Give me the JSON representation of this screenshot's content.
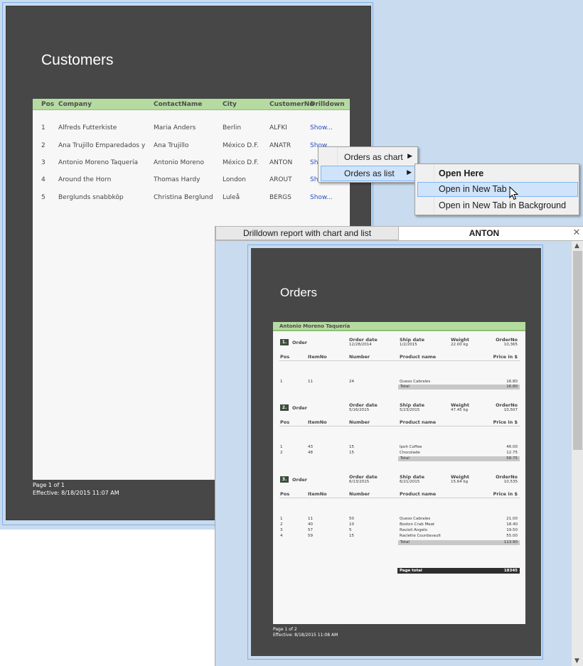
{
  "customers_report": {
    "title": "Customers",
    "columns": [
      "Pos",
      "Company",
      "ContactName",
      "City",
      "CustomerNo",
      "Drilldown"
    ],
    "rows": [
      {
        "pos": "1",
        "company": "Alfreds Futterkiste",
        "contact": "Maria Anders",
        "city": "Berlin",
        "no": "ALFKI",
        "drill": "Show..."
      },
      {
        "pos": "2",
        "company": "Ana Trujillo Emparedados y",
        "contact": "Ana Trujillo",
        "city": "México D.F.",
        "no": "ANATR",
        "drill": "Show..."
      },
      {
        "pos": "3",
        "company": "Antonio Moreno Taquería",
        "contact": "Antonio Moreno",
        "city": "México D.F.",
        "no": "ANTON",
        "drill": "Show..."
      },
      {
        "pos": "4",
        "company": "Around the Horn",
        "contact": "Thomas Hardy",
        "city": "London",
        "no": "AROUT",
        "drill": "Show..."
      },
      {
        "pos": "5",
        "company": "Berglunds snabbköp",
        "contact": "Christina Berglund",
        "city": "Luleå",
        "no": "BERGS",
        "drill": "Show..."
      }
    ],
    "footer_page": "Page 1 of 1",
    "footer_effective": "Effective: 8/18/2015 11:07 AM"
  },
  "context_menu": {
    "items": [
      {
        "label": "Orders as chart",
        "selected": false
      },
      {
        "label": "Orders as list",
        "selected": true
      }
    ],
    "submenu": [
      {
        "label": "Open Here",
        "bold": true,
        "selected": false
      },
      {
        "label": "Open in New Tab",
        "bold": false,
        "selected": true
      },
      {
        "label": "Open in New Tab in Background",
        "bold": false,
        "selected": false
      }
    ]
  },
  "tabs": {
    "tab1": "Drilldown report with chart and list",
    "tab2": "ANTON",
    "close": "✕"
  },
  "orders_report": {
    "title": "Orders",
    "customer": "Antonio Moreno Taquería",
    "group_headers": {
      "order": "Order",
      "order_date": "Order date",
      "ship_date": "Ship date",
      "weight": "Weight",
      "order_no": "OrderNo"
    },
    "item_headers": {
      "pos": "Pos",
      "item_no": "ItemNo",
      "number": "Number",
      "product": "Product name",
      "price": "Price in $"
    },
    "total_label": "Total",
    "page_total_label": "Page total",
    "page_total_value": "18345",
    "orders": [
      {
        "num": "1.",
        "order_date": "12/28/2014",
        "ship_date": "1/2/2015",
        "weight": "22.00 kg",
        "order_no": "10,365",
        "items": [
          {
            "pos": "1",
            "item": "11",
            "number": "24",
            "product": "Queso Cabrales",
            "price": "16.80"
          }
        ],
        "total": "16.80"
      },
      {
        "num": "2.",
        "order_date": "5/16/2015",
        "ship_date": "5/23/2015",
        "weight": "47.45 kg",
        "order_no": "10,507",
        "items": [
          {
            "pos": "1",
            "item": "43",
            "number": "15",
            "product": "Ipoh Coffee",
            "price": "46.00"
          },
          {
            "pos": "2",
            "item": "48",
            "number": "15",
            "product": "Chocolade",
            "price": "12.75"
          }
        ],
        "total": "58.75"
      },
      {
        "num": "3.",
        "order_date": "6/13/2015",
        "ship_date": "6/21/2015",
        "weight": "15.64 kg",
        "order_no": "10,535",
        "items": [
          {
            "pos": "1",
            "item": "11",
            "number": "50",
            "product": "Queso Cabrales",
            "price": "21.00"
          },
          {
            "pos": "2",
            "item": "40",
            "number": "10",
            "product": "Boston Crab Meat",
            "price": "18.40"
          },
          {
            "pos": "3",
            "item": "57",
            "number": "5",
            "product": "Ravioli Angelo",
            "price": "19.50"
          },
          {
            "pos": "4",
            "item": "59",
            "number": "15",
            "product": "Raclette Courdavault",
            "price": "55.00"
          }
        ],
        "total": "113.90"
      }
    ],
    "footer_page": "Page 1 of 2",
    "footer_effective": "Effective: 8/18/2015 11:08 AM"
  }
}
